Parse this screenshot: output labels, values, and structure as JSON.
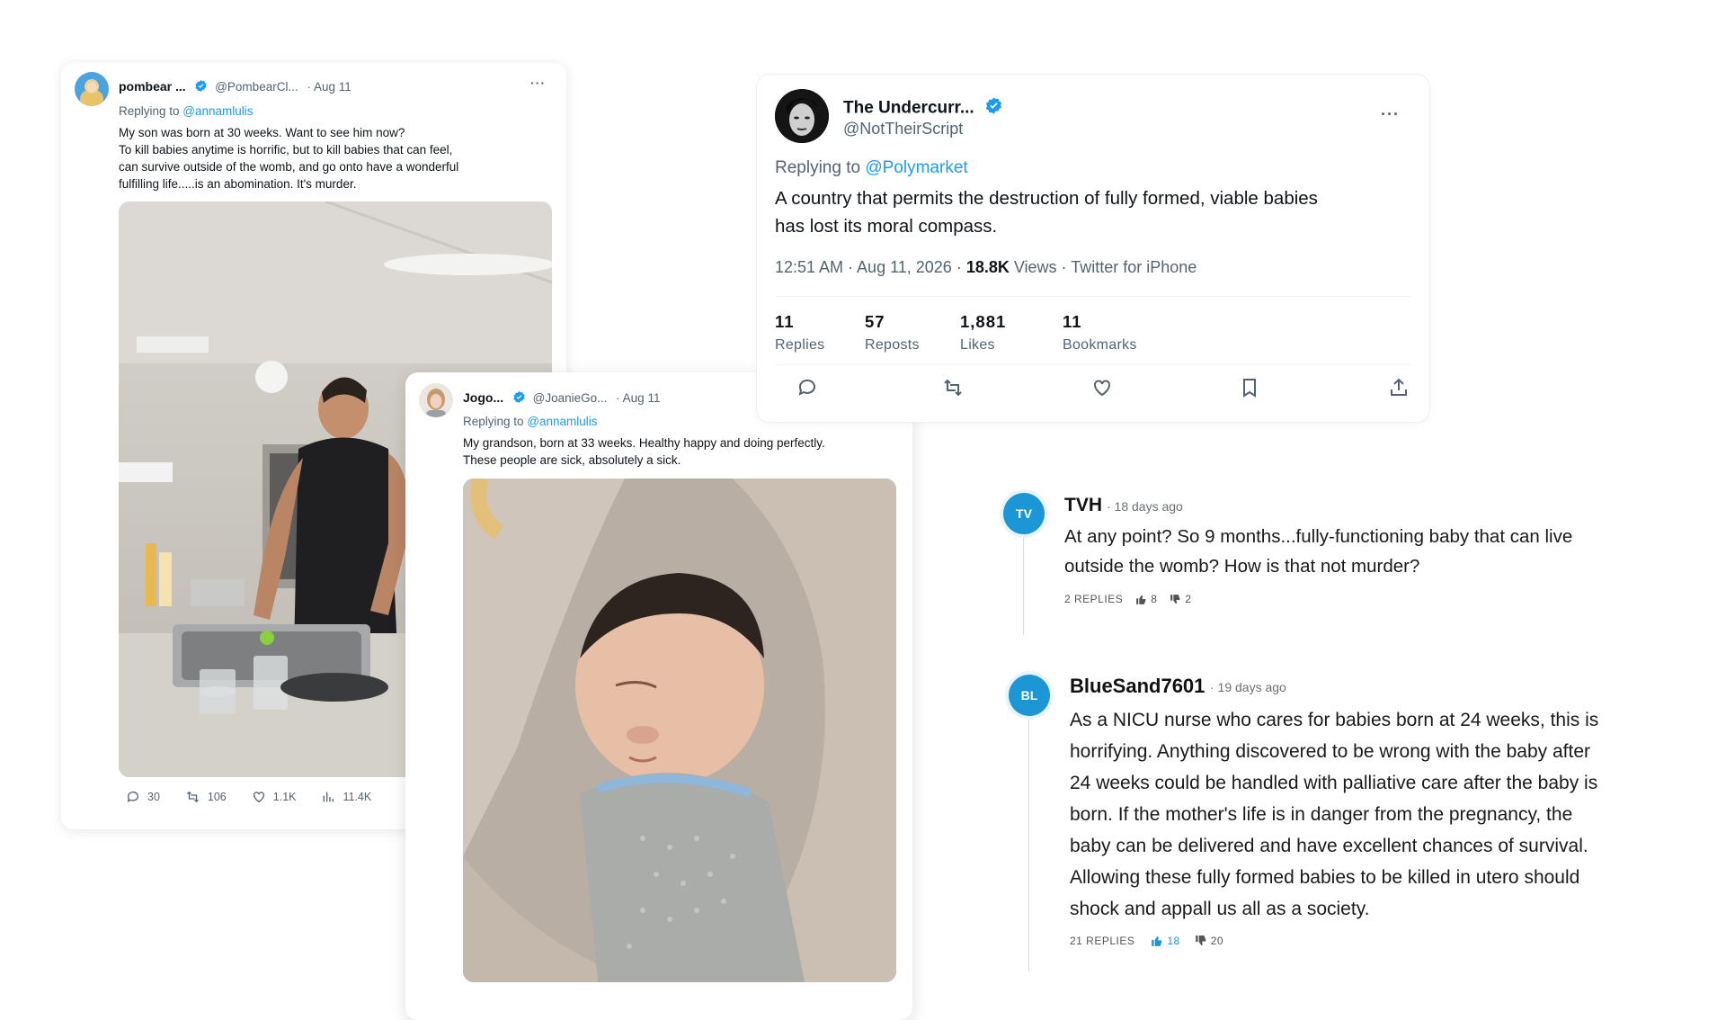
{
  "tweet_left": {
    "name": "pombear ...",
    "handle": "@PombearCl...",
    "date": "· Aug 11",
    "more": "···",
    "replying_prefix": "Replying to ",
    "replying_to": "@annamlulis",
    "text_lines": [
      "My son was born at 30 weeks. Want to see him now?",
      "To kill babies anytime is horrific, but to kill babies that can feel,",
      "can survive outside of the womb, and go onto have a wonderful",
      "fulfilling life.....is an abomination. It's murder."
    ],
    "replies": "30",
    "reposts": "106",
    "likes": "1.1K",
    "views": "11.4K"
  },
  "tweet_middle": {
    "name": "Jogo...",
    "handle": "@JoanieGo...",
    "date": "· Aug 11",
    "more": "···",
    "replying_prefix": "Replying to ",
    "replying_to": "@annamlulis",
    "text_lines": [
      "My grandson, born at 33 weeks. Healthy happy and doing perfectly.",
      "These people are sick, absolutely a sick."
    ]
  },
  "tweet_main": {
    "name": "The Undercurr...",
    "handle": "@NotTheirScript",
    "more": "···",
    "replying_prefix": "Replying to ",
    "replying_to": "@Polymarket",
    "text_lines": [
      "A country that permits the destruction of fully formed, viable babies",
      "has lost its moral compass."
    ],
    "time": "12:51 AM · Aug 11, 2026 · ",
    "views_count": "18.8K",
    "views_label": " Views · Twitter for iPhone",
    "stats": [
      {
        "n": "11",
        "l": "Replies"
      },
      {
        "n": "57",
        "l": "Reposts"
      },
      {
        "n": "1,881",
        "l": "Likes"
      },
      {
        "n": "11",
        "l": "Bookmarks"
      }
    ]
  },
  "comments": [
    {
      "initials": "TV",
      "name": "TVH",
      "time": "· 18 days ago",
      "text_lines": [
        "At any point? So 9 months...fully-functioning baby that can live",
        "outside the womb? How is that not murder?"
      ],
      "replies": "2 REPLIES",
      "up": "8",
      "down": "2"
    },
    {
      "initials": "BL",
      "name": "BlueSand7601",
      "time": "· 19 days ago",
      "text_lines": [
        "As a NICU nurse who cares for babies born at 24 weeks, this is",
        "horrifying. Anything discovered to be wrong with the baby after",
        "24 weeks could be handled with palliative care after the baby is",
        "born. If the mother's life is in danger from the pregnancy, the",
        "baby can be delivered and have excellent chances of survival.",
        "Allowing these fully formed babies to be killed in utero should",
        "shock and appall us all as a society."
      ],
      "replies": "21 REPLIES",
      "up": "18",
      "down": "20"
    }
  ],
  "colors": {
    "accent": "#1d9bf0",
    "avatar_blue": "#1d96d6"
  }
}
